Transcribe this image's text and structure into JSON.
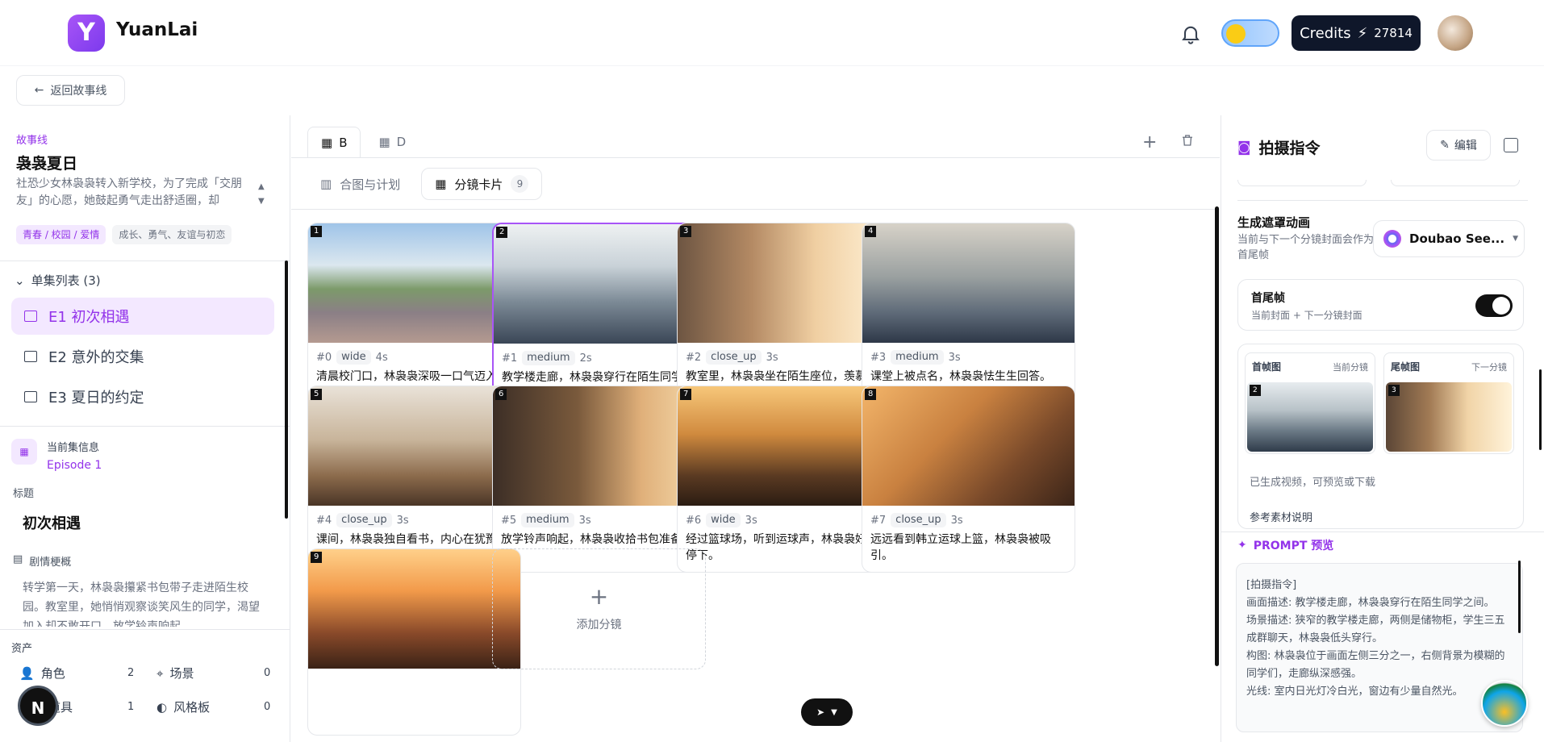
{
  "app": {
    "brand": "YuanLai",
    "logo_letter": "Y"
  },
  "header": {
    "credits_label": "Credits",
    "credits_value": "27814"
  },
  "back_button": {
    "label": "返回故事线"
  },
  "storyline": {
    "section_label": "故事线",
    "title": "袅袅夏日",
    "description": "社恐少女林袅袅转入新学校，为了完成「交朋友」的心愿，她鼓起勇气走出舒适圈，却",
    "tags": [
      "青春 / 校园 / 爱情",
      "成长、勇气、友谊与初恋"
    ]
  },
  "episode_list": {
    "header": "单集列表 (3)",
    "items": [
      "E1 初次相遇",
      "E2 意外的交集",
      "E3 夏日的约定"
    ]
  },
  "current_episode": {
    "label": "当前集信息",
    "value": "Episode 1",
    "title_label": "标题",
    "title": "初次相遇",
    "synopsis_label": "剧情梗概",
    "synopsis": "转学第一天，林袅袅攥紧书包带子走进陌生校园。教室里，她悄悄观察谈笑风生的同学，渴望加入却不敢开口。放学铃声响起，"
  },
  "assets": {
    "label": "资产",
    "items": [
      {
        "name": "角色",
        "count": "2"
      },
      {
        "name": "场景",
        "count": "0"
      },
      {
        "name": "道具",
        "count": "1"
      },
      {
        "name": "风格板",
        "count": "0"
      }
    ]
  },
  "floating": {
    "n_button": "N"
  },
  "tabs": {
    "top": [
      "B",
      "D"
    ],
    "sub": [
      {
        "label": "合图与计划",
        "count": ""
      },
      {
        "label": "分镜卡片",
        "count": "9"
      }
    ]
  },
  "storyboard": {
    "cards": [
      {
        "index": "1",
        "shot": "#0",
        "type": "wide",
        "dur": "4s",
        "desc": "清晨校门口，林袅袅深吸一口气迈入新学校。"
      },
      {
        "index": "2",
        "shot": "#1",
        "type": "medium",
        "dur": "2s",
        "desc": "教学楼走廊，林袅袅穿行在陌生同学之间。"
      },
      {
        "index": "3",
        "shot": "#2",
        "type": "close_up",
        "dur": "3s",
        "desc": "教室里，林袅袅坐在陌生座位，羡慕地看同学聊天。"
      },
      {
        "index": "4",
        "shot": "#3",
        "type": "medium",
        "dur": "3s",
        "desc": "课堂上被点名，林袅袅怯生生回答。"
      },
      {
        "index": "5",
        "shot": "#4",
        "type": "close_up",
        "dur": "3s",
        "desc": "课间，林袅袅独自看书，内心在犹豫是否主动交流。"
      },
      {
        "index": "6",
        "shot": "#5",
        "type": "medium",
        "dur": "3s",
        "desc": "放学铃声响起，林袅袅收拾书包准备离开。"
      },
      {
        "index": "7",
        "shot": "#6",
        "type": "wide",
        "dur": "3s",
        "desc": "经过篮球场，听到运球声，林袅袅好奇停下。"
      },
      {
        "index": "8",
        "shot": "#7",
        "type": "close_up",
        "dur": "3s",
        "desc": "远远看到韩立运球上篮，林袅袅被吸引。"
      },
      {
        "index": "9",
        "shot": "",
        "type": "",
        "dur": "",
        "desc": ""
      }
    ],
    "add_label": "添加分镜"
  },
  "right_panel": {
    "title": "拍摄指令",
    "edit_label": "编辑",
    "gen_mask_title": "生成遮罩动画",
    "gen_mask_sub": "当前与下一个分镜封面会作为首尾帧",
    "model": "Doubao See...",
    "first_last_title": "首尾帧",
    "first_last_sub": "当前封面 + 下一分镜封面",
    "first_frame_label": "首帧图",
    "first_frame_hint": "当前分镜",
    "last_frame_label": "尾帧图",
    "last_frame_hint": "下一分镜",
    "first_frame_num": "2",
    "last_frame_num": "3",
    "generated_note": "已生成视频，可预览或下载",
    "reference_label": "参考素材说明",
    "prompt_header": "PROMPT 预览",
    "prompt_lines": [
      "[拍摄指令]",
      "画面描述: 教学楼走廊，林袅袅穿行在陌生同学之间。",
      "场景描述: 狭窄的教学楼走廊，两侧是储物柜，学生三五成群聊天，林袅袅低头穿行。",
      "构图: 林袅袅位于画面左侧三分之一，右侧背景为模糊的同学们，走廊纵深感强。",
      "光线: 室内日光灯冷白光，窗边有少量自然光。"
    ]
  },
  "colors": {
    "accent": "#9333ea",
    "accent_bg": "#f3e8ff",
    "dark": "#0f172a"
  }
}
